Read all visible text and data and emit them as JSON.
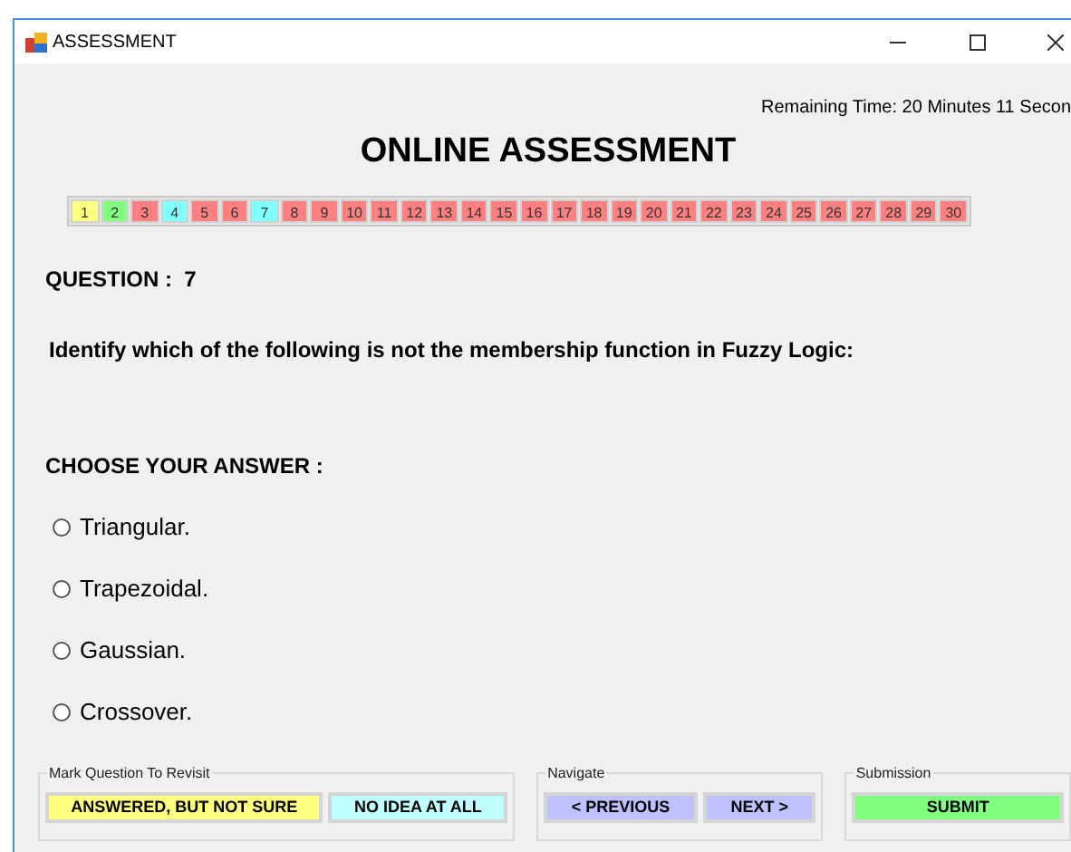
{
  "window": {
    "title": "ASSESSMENT"
  },
  "remaining_time": "Remaining Time: 20 Minutes 11 Secon",
  "heading": "ONLINE ASSESSMENT",
  "question_buttons": [
    {
      "label": "1",
      "color": "#ffff80"
    },
    {
      "label": "2",
      "color": "#80ff80"
    },
    {
      "label": "3",
      "color": "#ff8080"
    },
    {
      "label": "4",
      "color": "#80ffff"
    },
    {
      "label": "5",
      "color": "#ff8080"
    },
    {
      "label": "6",
      "color": "#ff8080"
    },
    {
      "label": "7",
      "color": "#80ffff"
    },
    {
      "label": "8",
      "color": "#ff8080"
    },
    {
      "label": "9",
      "color": "#ff8080"
    },
    {
      "label": "10",
      "color": "#ff8080"
    },
    {
      "label": "11",
      "color": "#ff8080"
    },
    {
      "label": "12",
      "color": "#ff8080"
    },
    {
      "label": "13",
      "color": "#ff8080"
    },
    {
      "label": "14",
      "color": "#ff8080"
    },
    {
      "label": "15",
      "color": "#ff8080"
    },
    {
      "label": "16",
      "color": "#ff8080"
    },
    {
      "label": "17",
      "color": "#ff8080"
    },
    {
      "label": "18",
      "color": "#ff8080"
    },
    {
      "label": "19",
      "color": "#ff8080"
    },
    {
      "label": "20",
      "color": "#ff8080"
    },
    {
      "label": "21",
      "color": "#ff8080"
    },
    {
      "label": "22",
      "color": "#ff8080"
    },
    {
      "label": "23",
      "color": "#ff8080"
    },
    {
      "label": "24",
      "color": "#ff8080"
    },
    {
      "label": "25",
      "color": "#ff8080"
    },
    {
      "label": "26",
      "color": "#ff8080"
    },
    {
      "label": "27",
      "color": "#ff8080"
    },
    {
      "label": "28",
      "color": "#ff8080"
    },
    {
      "label": "29",
      "color": "#ff8080"
    },
    {
      "label": "30",
      "color": "#ff8080"
    }
  ],
  "question_number": "QUESTION :  7",
  "question_text": "Identify which of the following is not the membership function in Fuzzy Logic:",
  "answer_prompt": "CHOOSE YOUR ANSWER :",
  "options": [
    {
      "label": "Triangular.",
      "selected": false
    },
    {
      "label": "Trapezoidal.",
      "selected": false
    },
    {
      "label": "Gaussian.",
      "selected": false
    },
    {
      "label": "Crossover.",
      "selected": false
    }
  ],
  "groups": [
    {
      "title": "Mark Question To Revisit",
      "buttons": [
        {
          "label": "ANSWERED, BUT NOT SURE",
          "color": "#ffff80"
        },
        {
          "label": "NO IDEA AT ALL",
          "color": "#c0ffff"
        }
      ]
    },
    {
      "title": "Navigate",
      "buttons": [
        {
          "label": "< PREVIOUS",
          "color": "#c0c0ff"
        },
        {
          "label": "NEXT >",
          "color": "#c0c0ff"
        }
      ]
    },
    {
      "title": "Submission",
      "buttons": [
        {
          "label": "SUBMIT",
          "color": "#80ff80"
        }
      ]
    }
  ]
}
